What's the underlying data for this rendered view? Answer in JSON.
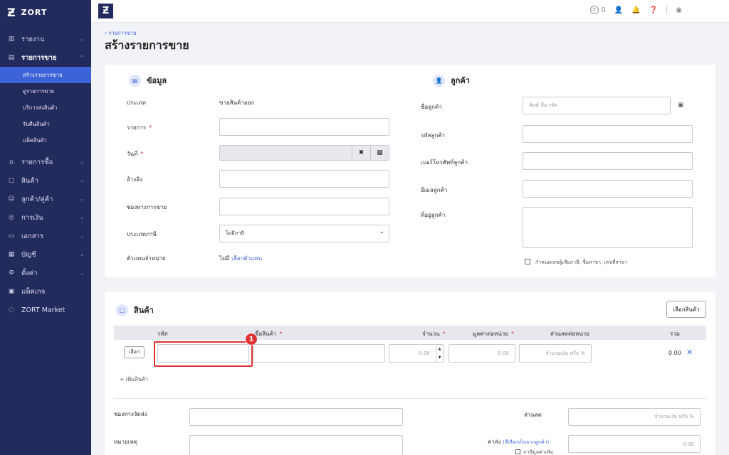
{
  "sidebar": {
    "brand": "ZORT",
    "items": [
      {
        "label": "รายงาน",
        "icon": "chart-icon"
      },
      {
        "label": "รายการขาย",
        "icon": "clipboard-icon"
      },
      {
        "label": "รายการซื้อ",
        "icon": "basket-icon"
      },
      {
        "label": "สินค้า",
        "icon": "box-icon"
      },
      {
        "label": "ลูกค้า/คู่ค้า",
        "icon": "users-icon"
      },
      {
        "label": "การเงิน",
        "icon": "coin-icon"
      },
      {
        "label": "เอกสาร",
        "icon": "document-icon"
      },
      {
        "label": "บัญชี",
        "icon": "ledger-icon"
      },
      {
        "label": "ตั้งค่า",
        "icon": "gear-icon"
      },
      {
        "label": "แพ็คเกจ",
        "icon": "package-icon"
      },
      {
        "label": "ZORT Market",
        "icon": "market-icon"
      }
    ],
    "sales_sub": [
      "สร้างรายการขาย",
      "ดูรายการขาย",
      "บริการส่งสินค้า",
      "รับคืนสินค้า",
      "แพ็คสินค้า"
    ]
  },
  "topbar": {
    "logo": "Ƶ",
    "coins": "0"
  },
  "breadcrumb": "‹ รายการขาย",
  "page_title": "สร้างรายการขาย",
  "info": {
    "title": "ข้อมูล",
    "type_label": "ประเภท",
    "type_value": "ขายสินค้าออก",
    "item_label": "รายการ",
    "date_label": "วันที่",
    "ref_label": "อ้างอิง",
    "channel_label": "ช่องทางการขาย",
    "tax_label": "ประเภทภาษี",
    "tax_value": "ไม่มีภาษี",
    "agent_label": "ตัวแทนจำหน่าย",
    "agent_value": "ไม่มี",
    "agent_link": "เลือกตัวแทน",
    "required": "*"
  },
  "customer": {
    "title": "ลูกค้า",
    "name_label": "ชื่อลูกค้า",
    "name_placeholder": "พิมพ์ ชื่อ,รหัส",
    "code_label": "รหัสลูกค้า",
    "phone_label": "เบอร์โทรศัพท์ลูกค้า",
    "email_label": "อีเมลลูกค้า",
    "address_label": "ที่อยู่ลูกค้า",
    "tax_checkbox_label": "กำหนดเลขผู้เสียภาษี, ชื่อสาขา, เลขที่สาขา"
  },
  "products": {
    "title": "สินค้า",
    "select_button": "เลือกสินค้า",
    "columns": {
      "code": "รหัส",
      "name": "ชื่อสินค้า",
      "qty": "จำนวน",
      "unit_price": "มูลค่าต่อหน่วย",
      "discount": "ส่วนลดต่อหน่วย",
      "total": "รวม"
    },
    "row": {
      "select": "เลือก",
      "qty": "0.00",
      "price": "0.00",
      "discount_placeholder": "จำนวนเงิน หรือ %",
      "total": "0.00"
    },
    "add_item": "+ เพิ่มสินค้า",
    "badge": "1"
  },
  "footer": {
    "shipping_label": "ช่องทางจัดส่ง",
    "note_label": "หมายเหตุ",
    "discount_label": "ส่วนลด",
    "discount_placeholder": "จำนวนเงิน หรือ %",
    "ship_cost_label": "ค่าส่ง",
    "ship_cost_note": "(ที่เรียกเก็บจากลูกค้า)",
    "ship_cost_value": "0.00",
    "vat_checkbox_label": "ภาษีมูลค่าเพิ่ม"
  }
}
